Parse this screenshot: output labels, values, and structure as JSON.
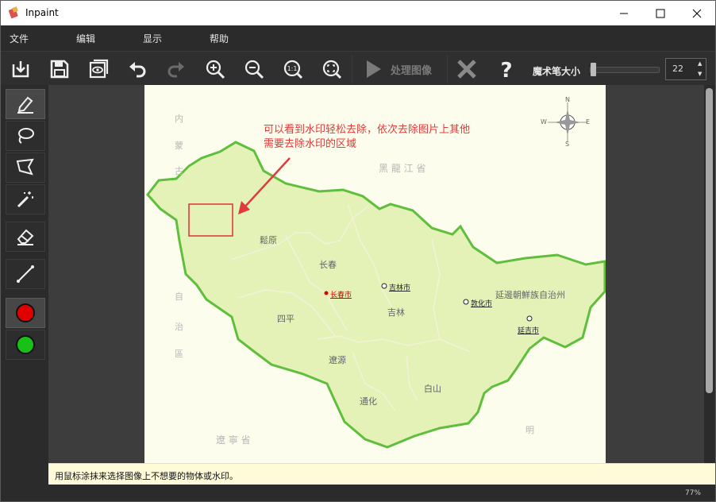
{
  "window": {
    "title": "Inpaint"
  },
  "menu": {
    "file": "文件",
    "edit": "编辑",
    "view": "显示",
    "help": "帮助"
  },
  "toolbar": {
    "process_label": "处理图像",
    "brush_size_label": "魔术笔大小",
    "brush_size_value": "22",
    "icons": [
      "open-icon",
      "save-icon",
      "preview-icon",
      "undo-icon",
      "redo-icon",
      "zoom-in-icon",
      "zoom-out-icon",
      "actual-size-icon",
      "fit-icon",
      "play-icon",
      "cancel-icon",
      "help-icon"
    ]
  },
  "tools": {
    "items": [
      "marker-icon",
      "lasso-icon",
      "polygon-lasso-icon",
      "magic-wand-icon",
      "eraser-icon",
      "line-icon"
    ],
    "colors": {
      "red": "#e10000",
      "green": "#18c018"
    }
  },
  "image": {
    "annotation": "可以看到水印轻松去除，依次去除图片上其他\n需要去除水印的区域",
    "compass": {
      "n": "N",
      "s": "S",
      "e": "E",
      "w": "W"
    },
    "labels": {
      "nei": "内",
      "meng": "蒙",
      "gu": "古",
      "heilongjiang": "黑 龍 江 省",
      "zi": "自",
      "zhi": "治",
      "qu": "區",
      "liaoning": "遼 寧 省",
      "ming": "明",
      "songyuan": "鬆原",
      "changchun_pref": "长春",
      "siping": "四平",
      "jilin_pref": "吉林",
      "liaoyuan": "遼源",
      "tonghua": "通化",
      "baishan": "白山",
      "yanbian": "延邊朝鮮族自治州",
      "changchun_city": "长春市",
      "jilin_city": "吉林市",
      "dunhua": "敦化市",
      "yanji": "延吉市"
    },
    "colors": {
      "region": "#e4f2b8",
      "border": "#5fbf3c",
      "watermark_box": "#e03b3b",
      "annotation": "#e03b3b"
    }
  },
  "hint": "用鼠标涂抹来选择图像上不想要的物体或水印。",
  "status": {
    "zoom": "77%"
  }
}
